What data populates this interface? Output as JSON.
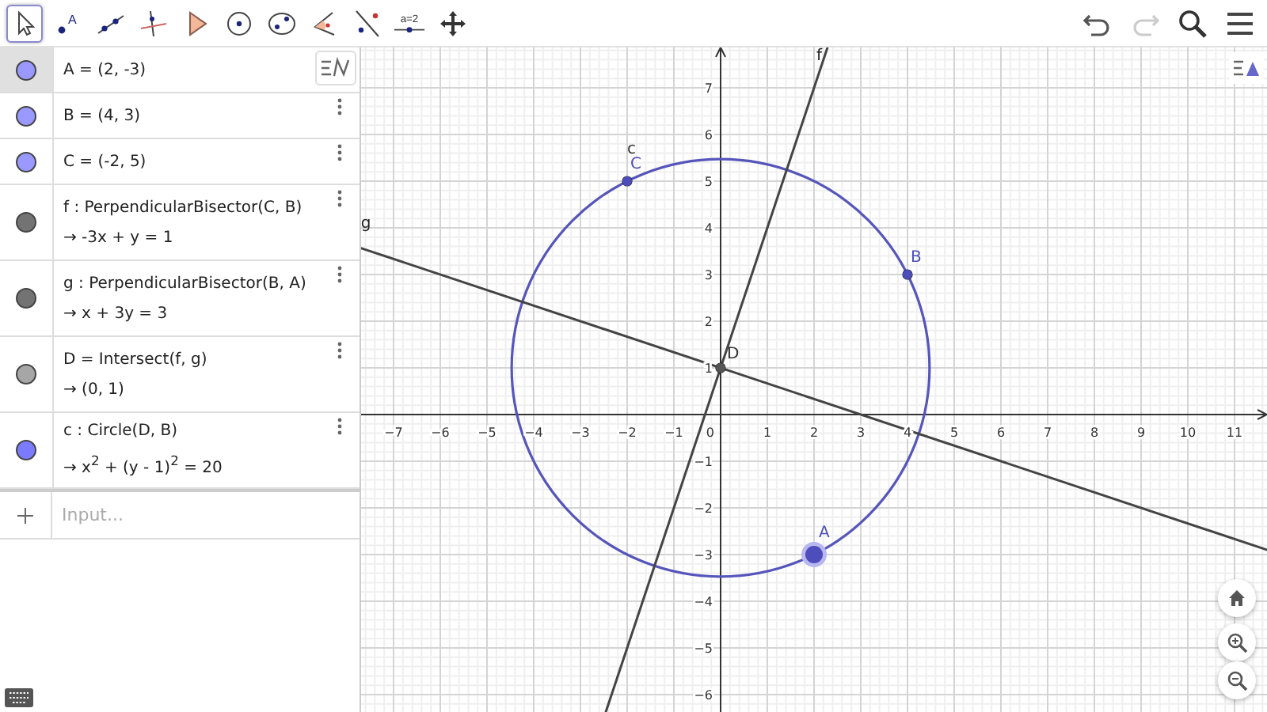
{
  "toolbar": {
    "tools": [
      {
        "kind": "move",
        "selected": true
      },
      {
        "kind": "point",
        "selected": false,
        "label": "A"
      },
      {
        "kind": "line",
        "selected": false
      },
      {
        "kind": "perpendicular",
        "selected": false
      },
      {
        "kind": "polygon",
        "selected": false
      },
      {
        "kind": "circle",
        "selected": false
      },
      {
        "kind": "conic",
        "selected": false
      },
      {
        "kind": "angle",
        "selected": false
      },
      {
        "kind": "reflect",
        "selected": false
      },
      {
        "kind": "slider",
        "selected": false,
        "label": "a=2"
      },
      {
        "kind": "pan",
        "selected": false
      }
    ],
    "actions": [
      {
        "kind": "undo",
        "disabled": false
      },
      {
        "kind": "redo",
        "disabled": true
      },
      {
        "kind": "search"
      },
      {
        "kind": "menu"
      }
    ]
  },
  "algebra": {
    "items": [
      {
        "definition": "A = (2, -3)",
        "color": "#9999ff",
        "selected": true
      },
      {
        "definition": "B = (4, 3)",
        "color": "#9999ff",
        "selected": false
      },
      {
        "definition": "C = (-2, 5)",
        "color": "#9999ff",
        "selected": false
      },
      {
        "definition": "f : PerpendicularBisector(C, B)",
        "result": "→  -3x + y = 1",
        "color": "#737373",
        "selected": false
      },
      {
        "definition": "g : PerpendicularBisector(B, A)",
        "result": "→  x + 3y = 3",
        "color": "#737373",
        "selected": false
      },
      {
        "definition": "D = Intersect(f, g)",
        "result": "→  (0, 1)",
        "color": "#a6a6a6",
        "selected": false
      },
      {
        "definition": "c : Circle(D, B)",
        "result": "→  x$^{2}$ + (y - 1)$^{2}$ = 20",
        "color": "#7b7bff",
        "selected": false
      }
    ],
    "input": {
      "placeholder": "Input..."
    }
  },
  "graphics": {
    "x_ticks": [
      "−7",
      "−6",
      "−5",
      "−4",
      "−3",
      "−2",
      "−1",
      "1",
      "2",
      "3",
      "4",
      "5",
      "6",
      "7",
      "8",
      "9",
      "10",
      "11"
    ],
    "y_ticks": [
      "7",
      "6",
      "5",
      "4",
      "3",
      "2",
      "1",
      "−1",
      "−2",
      "−3",
      "−4",
      "−5",
      "−6"
    ],
    "origin": "0",
    "objects": [
      {
        "name": "A",
        "selected": true
      },
      {
        "name": "B",
        "selected": false
      },
      {
        "name": "C",
        "selected": false
      },
      {
        "name": "D",
        "selected": false
      },
      {
        "name": "c"
      },
      {
        "name": "f"
      },
      {
        "name": "g"
      }
    ]
  }
}
